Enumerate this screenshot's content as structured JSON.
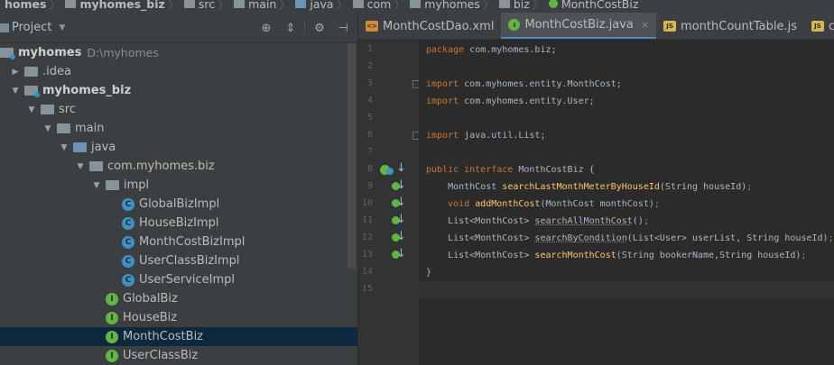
{
  "breadcrumb": [
    "homes",
    "myhomes_biz",
    "src",
    "main",
    "java",
    "com",
    "myhomes",
    "biz",
    "MonthCostBiz"
  ],
  "project_panel": {
    "title": "Project",
    "tree": [
      {
        "label": "myhomes",
        "path": "D:\\myhomes",
        "bold": true,
        "level": 0,
        "expanded": true,
        "type": "module"
      },
      {
        "label": ".idea",
        "level": 1,
        "expanded": false,
        "type": "folder"
      },
      {
        "label": "myhomes_biz",
        "level": 1,
        "expanded": true,
        "type": "module",
        "bold": true
      },
      {
        "label": "src",
        "level": 2,
        "expanded": true,
        "type": "folder"
      },
      {
        "label": "main",
        "level": 3,
        "expanded": true,
        "type": "folder"
      },
      {
        "label": "java",
        "level": 4,
        "expanded": true,
        "type": "source-folder"
      },
      {
        "label": "com.myhomes.biz",
        "level": 5,
        "expanded": true,
        "type": "package"
      },
      {
        "label": "impl",
        "level": 6,
        "expanded": true,
        "type": "package"
      },
      {
        "label": "GlobalBizImpl",
        "level": 7,
        "type": "class"
      },
      {
        "label": "HouseBizImpl",
        "level": 7,
        "type": "class"
      },
      {
        "label": "MonthCostBizImpl",
        "level": 7,
        "type": "class"
      },
      {
        "label": "UserClassBizImpl",
        "level": 7,
        "type": "class"
      },
      {
        "label": "UserServiceImpl",
        "level": 7,
        "type": "class"
      },
      {
        "label": "GlobalBiz",
        "level": 6,
        "type": "interface"
      },
      {
        "label": "HouseBiz",
        "level": 6,
        "type": "interface"
      },
      {
        "label": "MonthCostBiz",
        "level": 6,
        "type": "interface",
        "selected": true
      },
      {
        "label": "UserClassBiz",
        "level": 6,
        "type": "interface"
      }
    ]
  },
  "tabs": [
    {
      "label": "MonthCostDao.xml",
      "icon": "xml-icon",
      "active": false
    },
    {
      "label": "MonthCostBiz.java",
      "icon": "java-interface-icon",
      "active": true,
      "close": "×"
    },
    {
      "label": "monthCountTable.js",
      "icon": "js-icon",
      "active": false
    },
    {
      "label": "cou",
      "icon": "js-icon",
      "active": false
    }
  ],
  "editor": {
    "current_line": 15,
    "lines": [
      {
        "n": "1",
        "html": "<span class=\"k\">package </span>com.myhomes.biz;"
      },
      {
        "n": "2",
        "html": ""
      },
      {
        "n": "3",
        "html": "<span class=\"k\">import </span>com.myhomes.entity.MonthCost;",
        "fold": true
      },
      {
        "n": "4",
        "html": "<span class=\"k\">import </span>com.myhomes.entity.User;"
      },
      {
        "n": "5",
        "html": ""
      },
      {
        "n": "6",
        "html": "<span class=\"k\">import </span>java.util.List;",
        "fold": true
      },
      {
        "n": "7",
        "html": ""
      },
      {
        "n": "8",
        "html": "<span class=\"k\">public interface </span>MonthCostBiz {",
        "marker": "overridden"
      },
      {
        "n": "9",
        "html": "    MonthCost <span class=\"m\">searchLastMonthMeterByHouseId</span>(String houseId)<span class=\"k\">;</span>",
        "marker": "impl"
      },
      {
        "n": "10",
        "html": "    <span class=\"k\">void </span><span class=\"m\">addMonthCost</span>(MonthCost monthCost)<span class=\"k\">;</span>",
        "marker": "impl"
      },
      {
        "n": "11",
        "html": "    List&lt;MonthCost&gt; <span class=\"m u\">searchAllMonthCost</span>()<span class=\"k\">;</span>",
        "marker": "impl"
      },
      {
        "n": "12",
        "html": "    List&lt;MonthCost&gt; <span class=\"m u\">searchByCondition</span>(List&lt;User&gt; userList, String houseId)<span class=\"k\">;</span>",
        "marker": "impl"
      },
      {
        "n": "13",
        "html": "    List&lt;MonthCost&gt; <span class=\"m\">searchMonthCost</span>(String bookerName,String houseId)<span class=\"k\">;</span>",
        "marker": "impl"
      },
      {
        "n": "14",
        "html": "}"
      },
      {
        "n": "15",
        "html": ""
      }
    ]
  }
}
